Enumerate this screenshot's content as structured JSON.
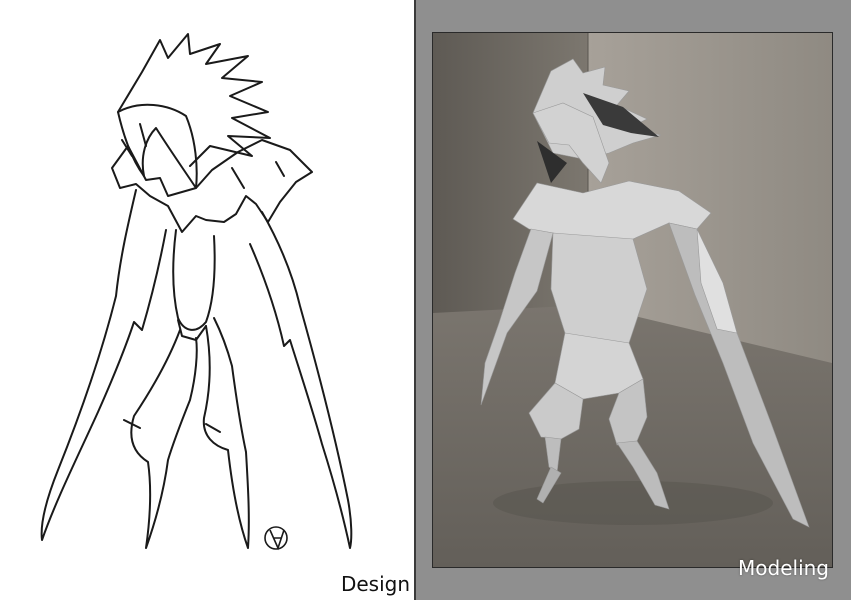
{
  "captions": {
    "design": "Design",
    "modeling": "Modeling"
  },
  "colors": {
    "sketch_line": "#1a1a1a",
    "render_background": "#8f8f8f",
    "render_wall": "#77726b",
    "render_floor": "#6e6962",
    "model_surface": "#d9d9d9"
  }
}
